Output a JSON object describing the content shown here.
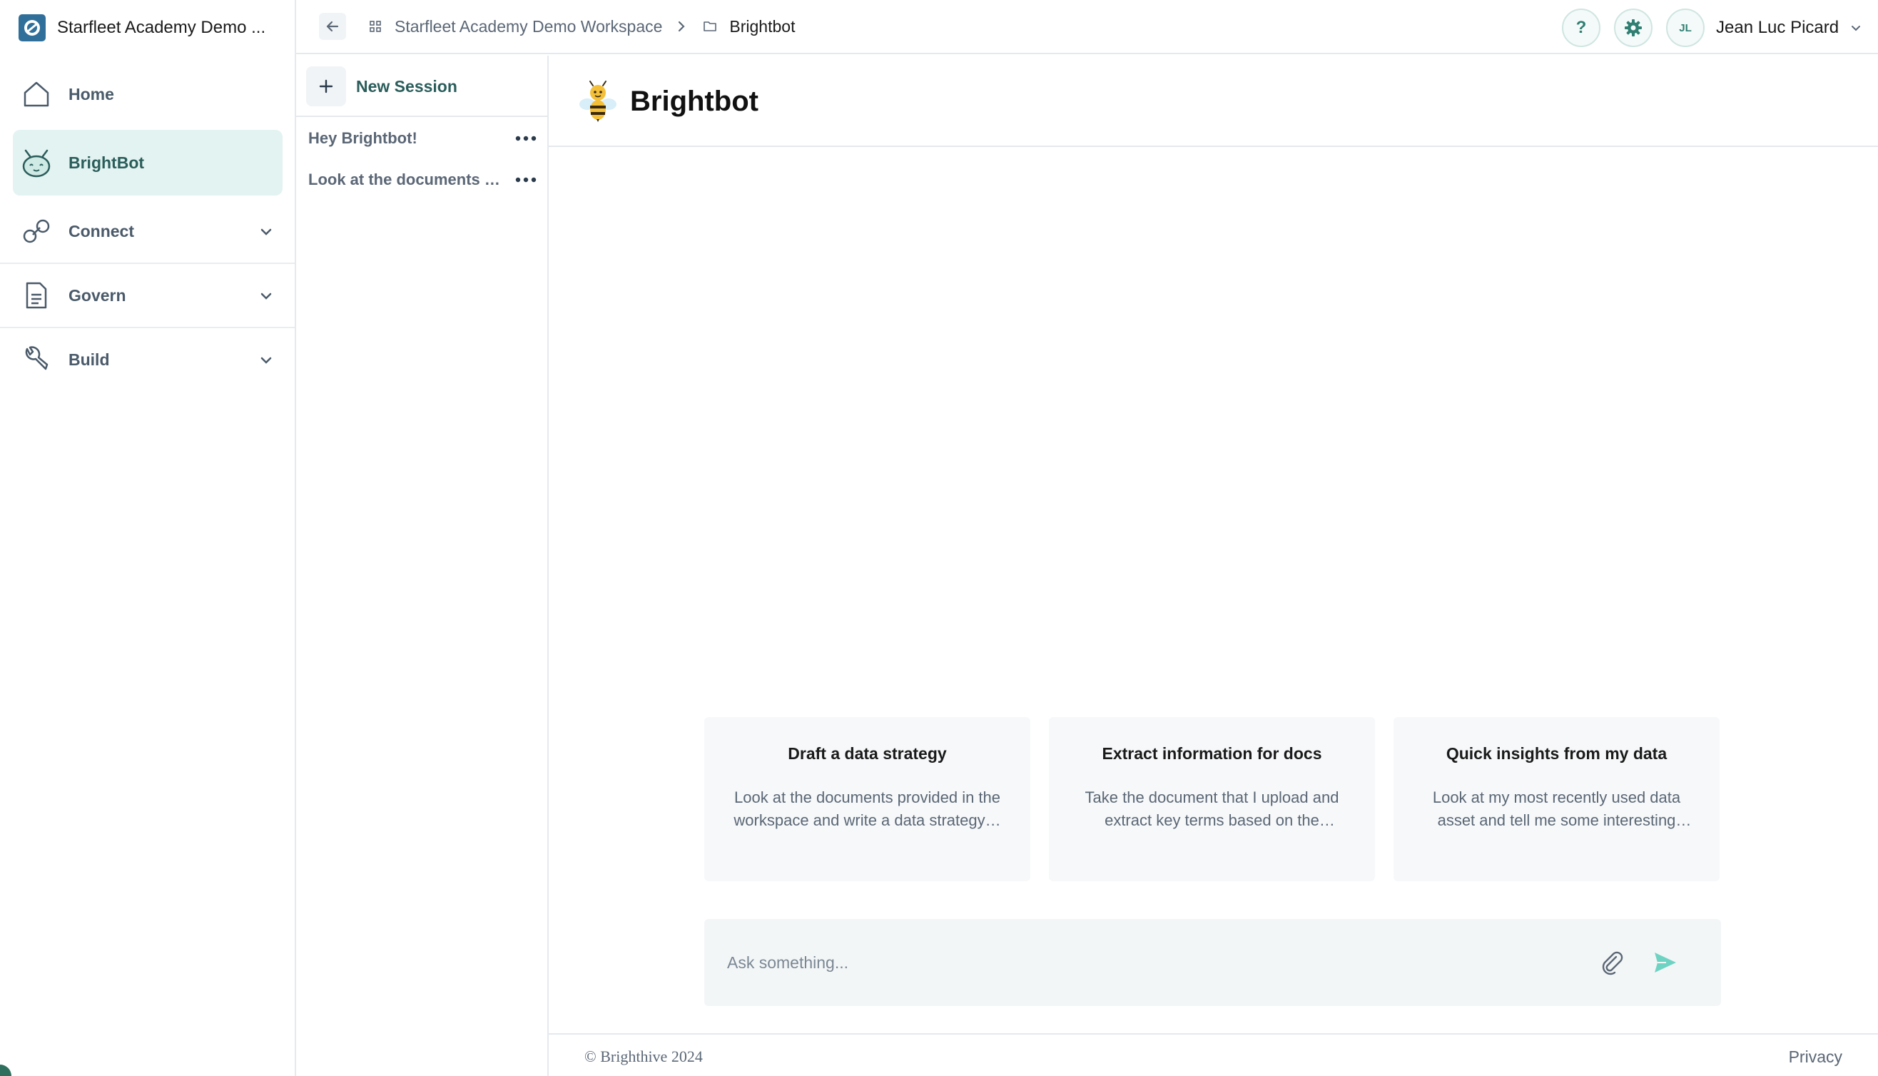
{
  "workspace": {
    "name": "Starfleet Academy Demo ..."
  },
  "nav": {
    "items": [
      {
        "label": "Home",
        "icon": "home-icon"
      },
      {
        "label": "BrightBot",
        "icon": "bot-icon",
        "active": true
      },
      {
        "label": "Connect",
        "icon": "link-icon",
        "expandable": true
      },
      {
        "label": "Govern",
        "icon": "document-icon",
        "expandable": true
      },
      {
        "label": "Build",
        "icon": "wrench-icon",
        "expandable": true
      }
    ]
  },
  "breadcrumb": {
    "workspace": "Starfleet Academy Demo Workspace",
    "current": "Brightbot"
  },
  "header": {
    "help_label": "?",
    "user": {
      "initials": "JL",
      "name": "Jean Luc Picard"
    }
  },
  "sessions": {
    "new_label": "New Session",
    "items": [
      {
        "label": "Hey Brightbot!"
      },
      {
        "label": "Look at the documents provided in the workspace"
      }
    ]
  },
  "main": {
    "title": "Brightbot",
    "suggestions": [
      {
        "title": "Draft a data strategy",
        "description": "Look at the documents provided in the workspace and write a data strategy…"
      },
      {
        "title": "Extract information for docs",
        "description": "Take the document that I upload and extract key terms based on the categor…"
      },
      {
        "title": "Quick insights from my data",
        "description": "Look at my most recently used data asset and tell me some interesting and…"
      }
    ],
    "composer": {
      "placeholder": "Ask something..."
    }
  },
  "footer": {
    "copyright": "© Brighthive 2024",
    "privacy": "Privacy"
  },
  "colors": {
    "accent": "#2a5d5a",
    "active_bg": "#e3f3f1",
    "send": "#6fd3c3"
  }
}
